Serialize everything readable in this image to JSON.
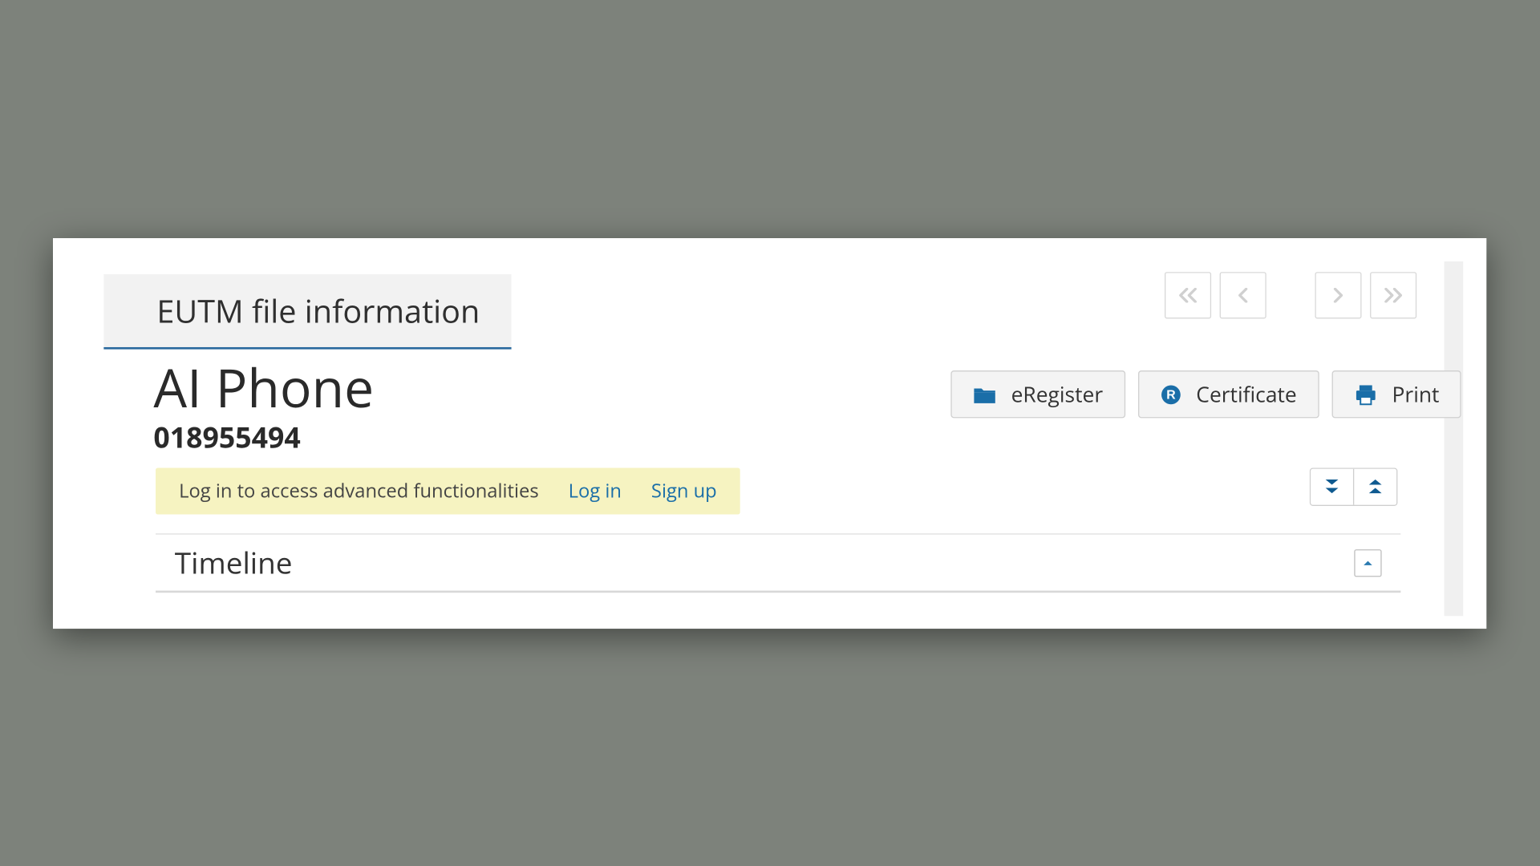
{
  "tab": {
    "label": "EUTM file information"
  },
  "record": {
    "title": "AI Phone",
    "number": "018955494"
  },
  "actions": {
    "eRegister": "eRegister",
    "certificate": "Certificate",
    "print": "Print"
  },
  "notice": {
    "text": "Log in to access advanced functionalities",
    "login": "Log in",
    "signup": "Sign up"
  },
  "section": {
    "timeline": "Timeline"
  }
}
